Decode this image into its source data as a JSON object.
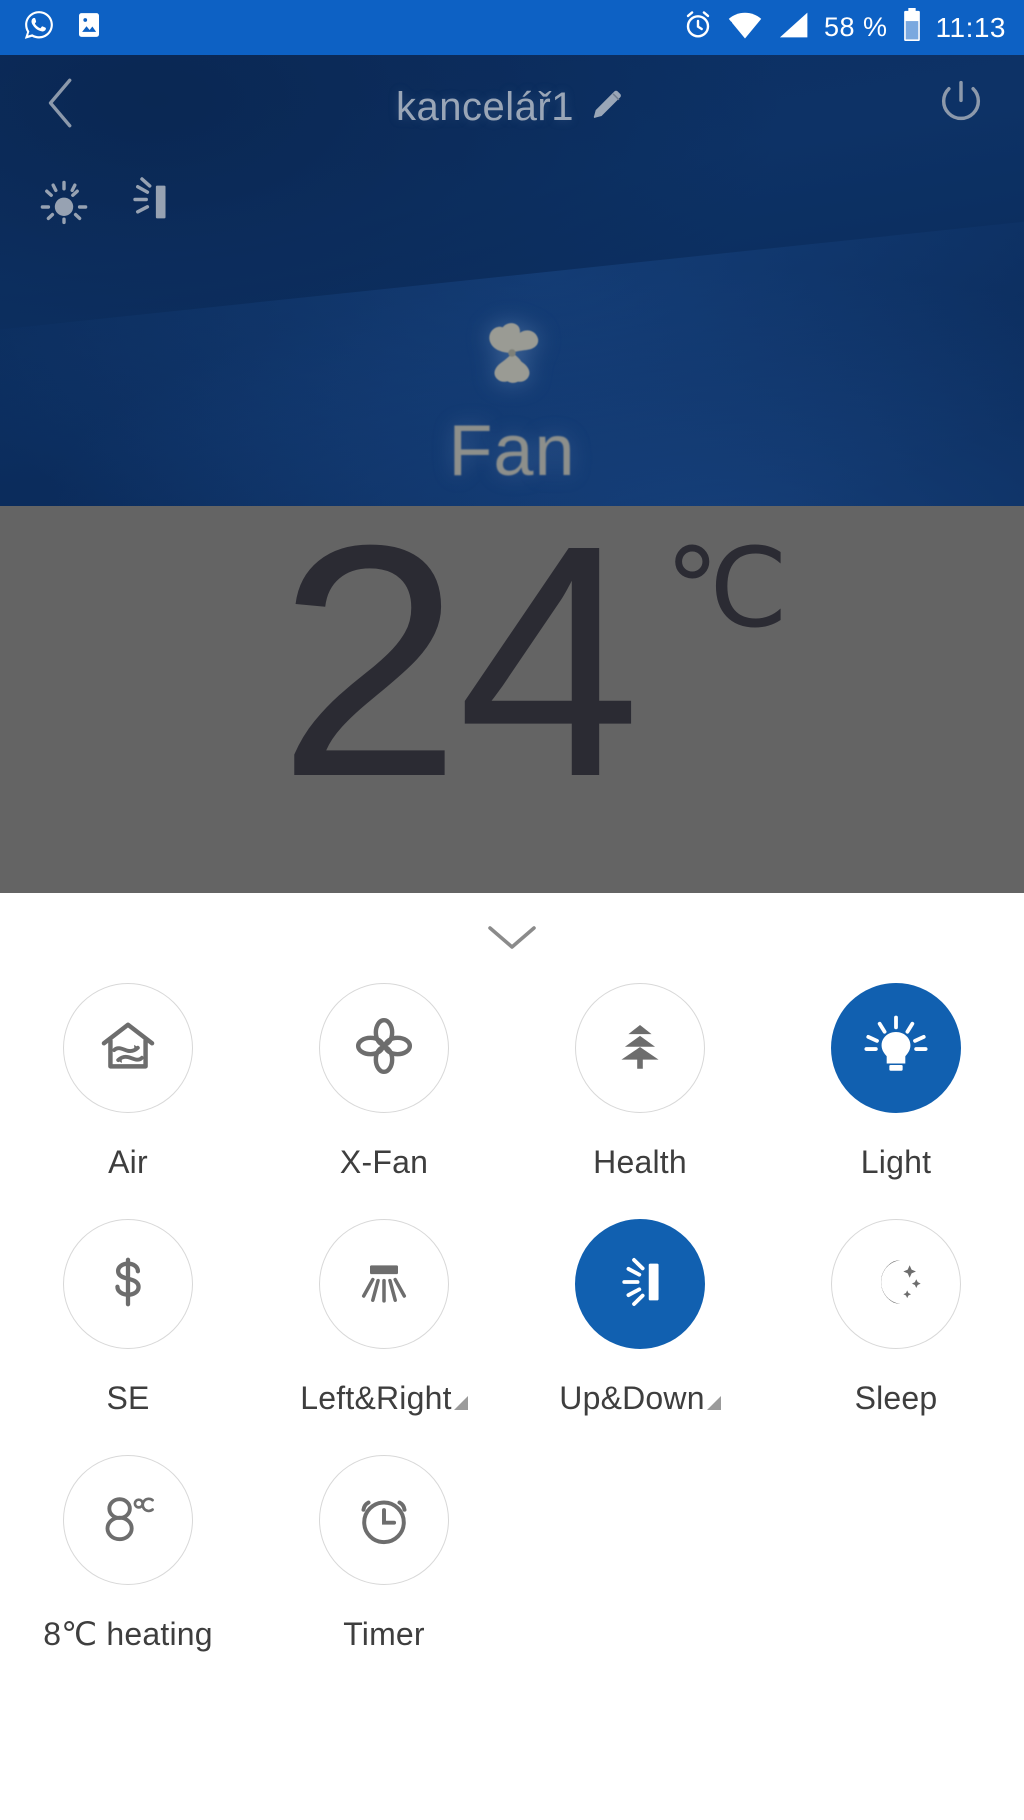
{
  "statusbar": {
    "icons_left": [
      "whatsapp-icon",
      "image-icon"
    ],
    "icons_right": [
      "alarm-icon",
      "wifi-icon",
      "signal-icon"
    ],
    "battery_percent": "58 %",
    "time": "11:13"
  },
  "header": {
    "back_icon": "back-chevron-icon",
    "title": "kancelář1",
    "edit_icon": "pencil-icon",
    "power_icon": "power-icon",
    "status_indicators": [
      {
        "name": "light-status-icon"
      },
      {
        "name": "updown-swing-status-icon"
      }
    ],
    "mode_icon": "fan-pinwheel-icon",
    "mode_label": "Fan"
  },
  "temperature": {
    "value": "24",
    "unit": "℃"
  },
  "sheet": {
    "collapse_icon": "chevron-down-icon",
    "functions": [
      {
        "label": "Air",
        "icon": "house-airflow-icon",
        "active": false,
        "has_corner": false
      },
      {
        "label": "X-Fan",
        "icon": "four-petal-fan-icon",
        "active": false,
        "has_corner": false
      },
      {
        "label": "Health",
        "icon": "pine-tree-icon",
        "active": false,
        "has_corner": false
      },
      {
        "label": "Light",
        "icon": "lightbulb-icon",
        "active": true,
        "has_corner": false
      },
      {
        "label": "SE",
        "icon": "dollar-icon",
        "active": false,
        "has_corner": false
      },
      {
        "label": "Left&Right",
        "icon": "left-right-swing-icon",
        "active": false,
        "has_corner": true
      },
      {
        "label": "Up&Down",
        "icon": "up-down-swing-icon",
        "active": true,
        "has_corner": true
      },
      {
        "label": "Sleep",
        "icon": "moon-stars-icon",
        "active": false,
        "has_corner": false
      },
      {
        "label": "8℃ heating",
        "icon": "eight-degree-icon",
        "active": false,
        "has_corner": false
      },
      {
        "label": "Timer",
        "icon": "alarm-clock-icon",
        "active": false,
        "has_corner": false
      }
    ]
  },
  "colors": {
    "status_bar_blue": "#0d61c4",
    "hero_navy": "#0c2f63",
    "temp_panel_gray": "#646464",
    "accent_blue": "#1160b0",
    "sheet_white": "#ffffff"
  }
}
